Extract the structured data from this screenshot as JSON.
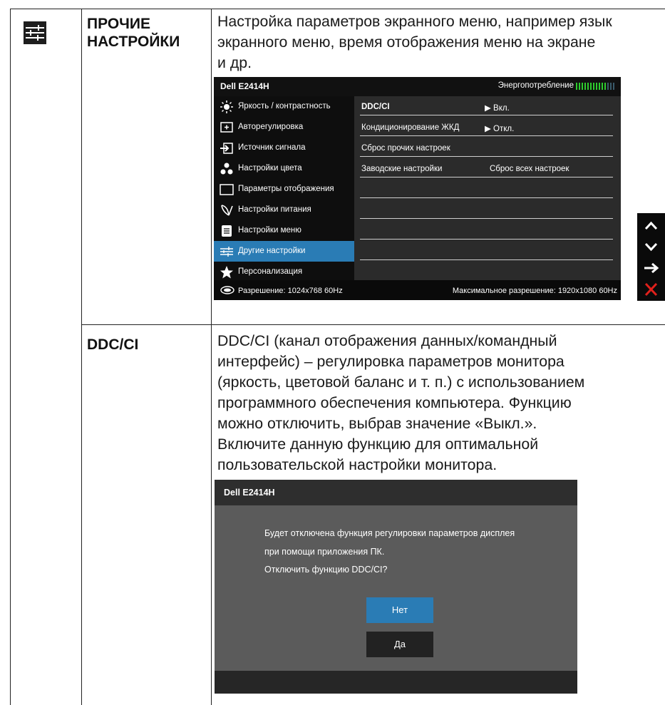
{
  "section1": {
    "title_line1": "ПРОЧИЕ",
    "title_line2": "НАСТРОЙКИ",
    "desc_line1": "Настройка параметров экранного меню, например язык",
    "desc_line2": "экранного меню, время отображения меню на экране",
    "desc_line3": "и др."
  },
  "osd": {
    "model": "Dell E2414H",
    "energy_label": "Энергопотребление",
    "menu": [
      {
        "label": "Яркость / контрастность",
        "icon": "brightness-icon"
      },
      {
        "label": "Авторегулировка",
        "icon": "auto-adjust-icon"
      },
      {
        "label": "Источник сигнала",
        "icon": "input-source-icon"
      },
      {
        "label": "Настройки цвета",
        "icon": "color-settings-icon"
      },
      {
        "label": "Параметры отображения",
        "icon": "display-settings-icon"
      },
      {
        "label": "Настройки питания",
        "icon": "power-settings-icon"
      },
      {
        "label": "Настройки меню",
        "icon": "menu-settings-icon"
      },
      {
        "label": "Другие настройки",
        "icon": "other-settings-icon",
        "active": true
      },
      {
        "label": "Персонализация",
        "icon": "star-icon"
      }
    ],
    "rows": {
      "ddc_label": "DDC/CI",
      "ddc_value": "▶ Вкл.",
      "lcd_label": "Кондиционирование ЖКД",
      "lcd_value": "▶ Откл.",
      "reset_other": "Сброс прочих настроек",
      "factory_label": "Заводские настройки",
      "factory_value": "Сброс всех настроек"
    },
    "resolution": "Разрешение: 1024x768 60Hz",
    "max_resolution": "Максимальное разрешение: 1920x1080 60Hz",
    "nav_icons": [
      "up-arrow-icon",
      "down-arrow-icon",
      "right-arrow-icon",
      "close-icon"
    ],
    "active_color": "#2a7cb5",
    "energy_color": "#2ecc2e",
    "close_color": "#e0201b"
  },
  "section2": {
    "title": "DDC/CI",
    "desc_line1": "DDC/CI (канал отображения данных/командный",
    "desc_line2": "интерфейс) – регулировка параметров монитора",
    "desc_line3": "(яркость, цветовой баланс и т. п.) с использованием",
    "desc_line4": "программного обеспечения компьютера. Функцию",
    "desc_line5": "можно отключить, выбрав значение «Выкл.».",
    "desc_line6": "Включите данную функцию для оптимальной",
    "desc_line7": "пользовательской настройки монитора."
  },
  "dialog": {
    "model": "Dell E2414H",
    "msg_line1": "Будет отключена функция регулировки параметров дисплея",
    "msg_line2": "при помощи приложения ПК.",
    "msg_line3": "Отключить функцию DDC/CI?",
    "btn_no": "Нет",
    "btn_yes": "Да",
    "btn_no_color": "#2a7cb5"
  }
}
